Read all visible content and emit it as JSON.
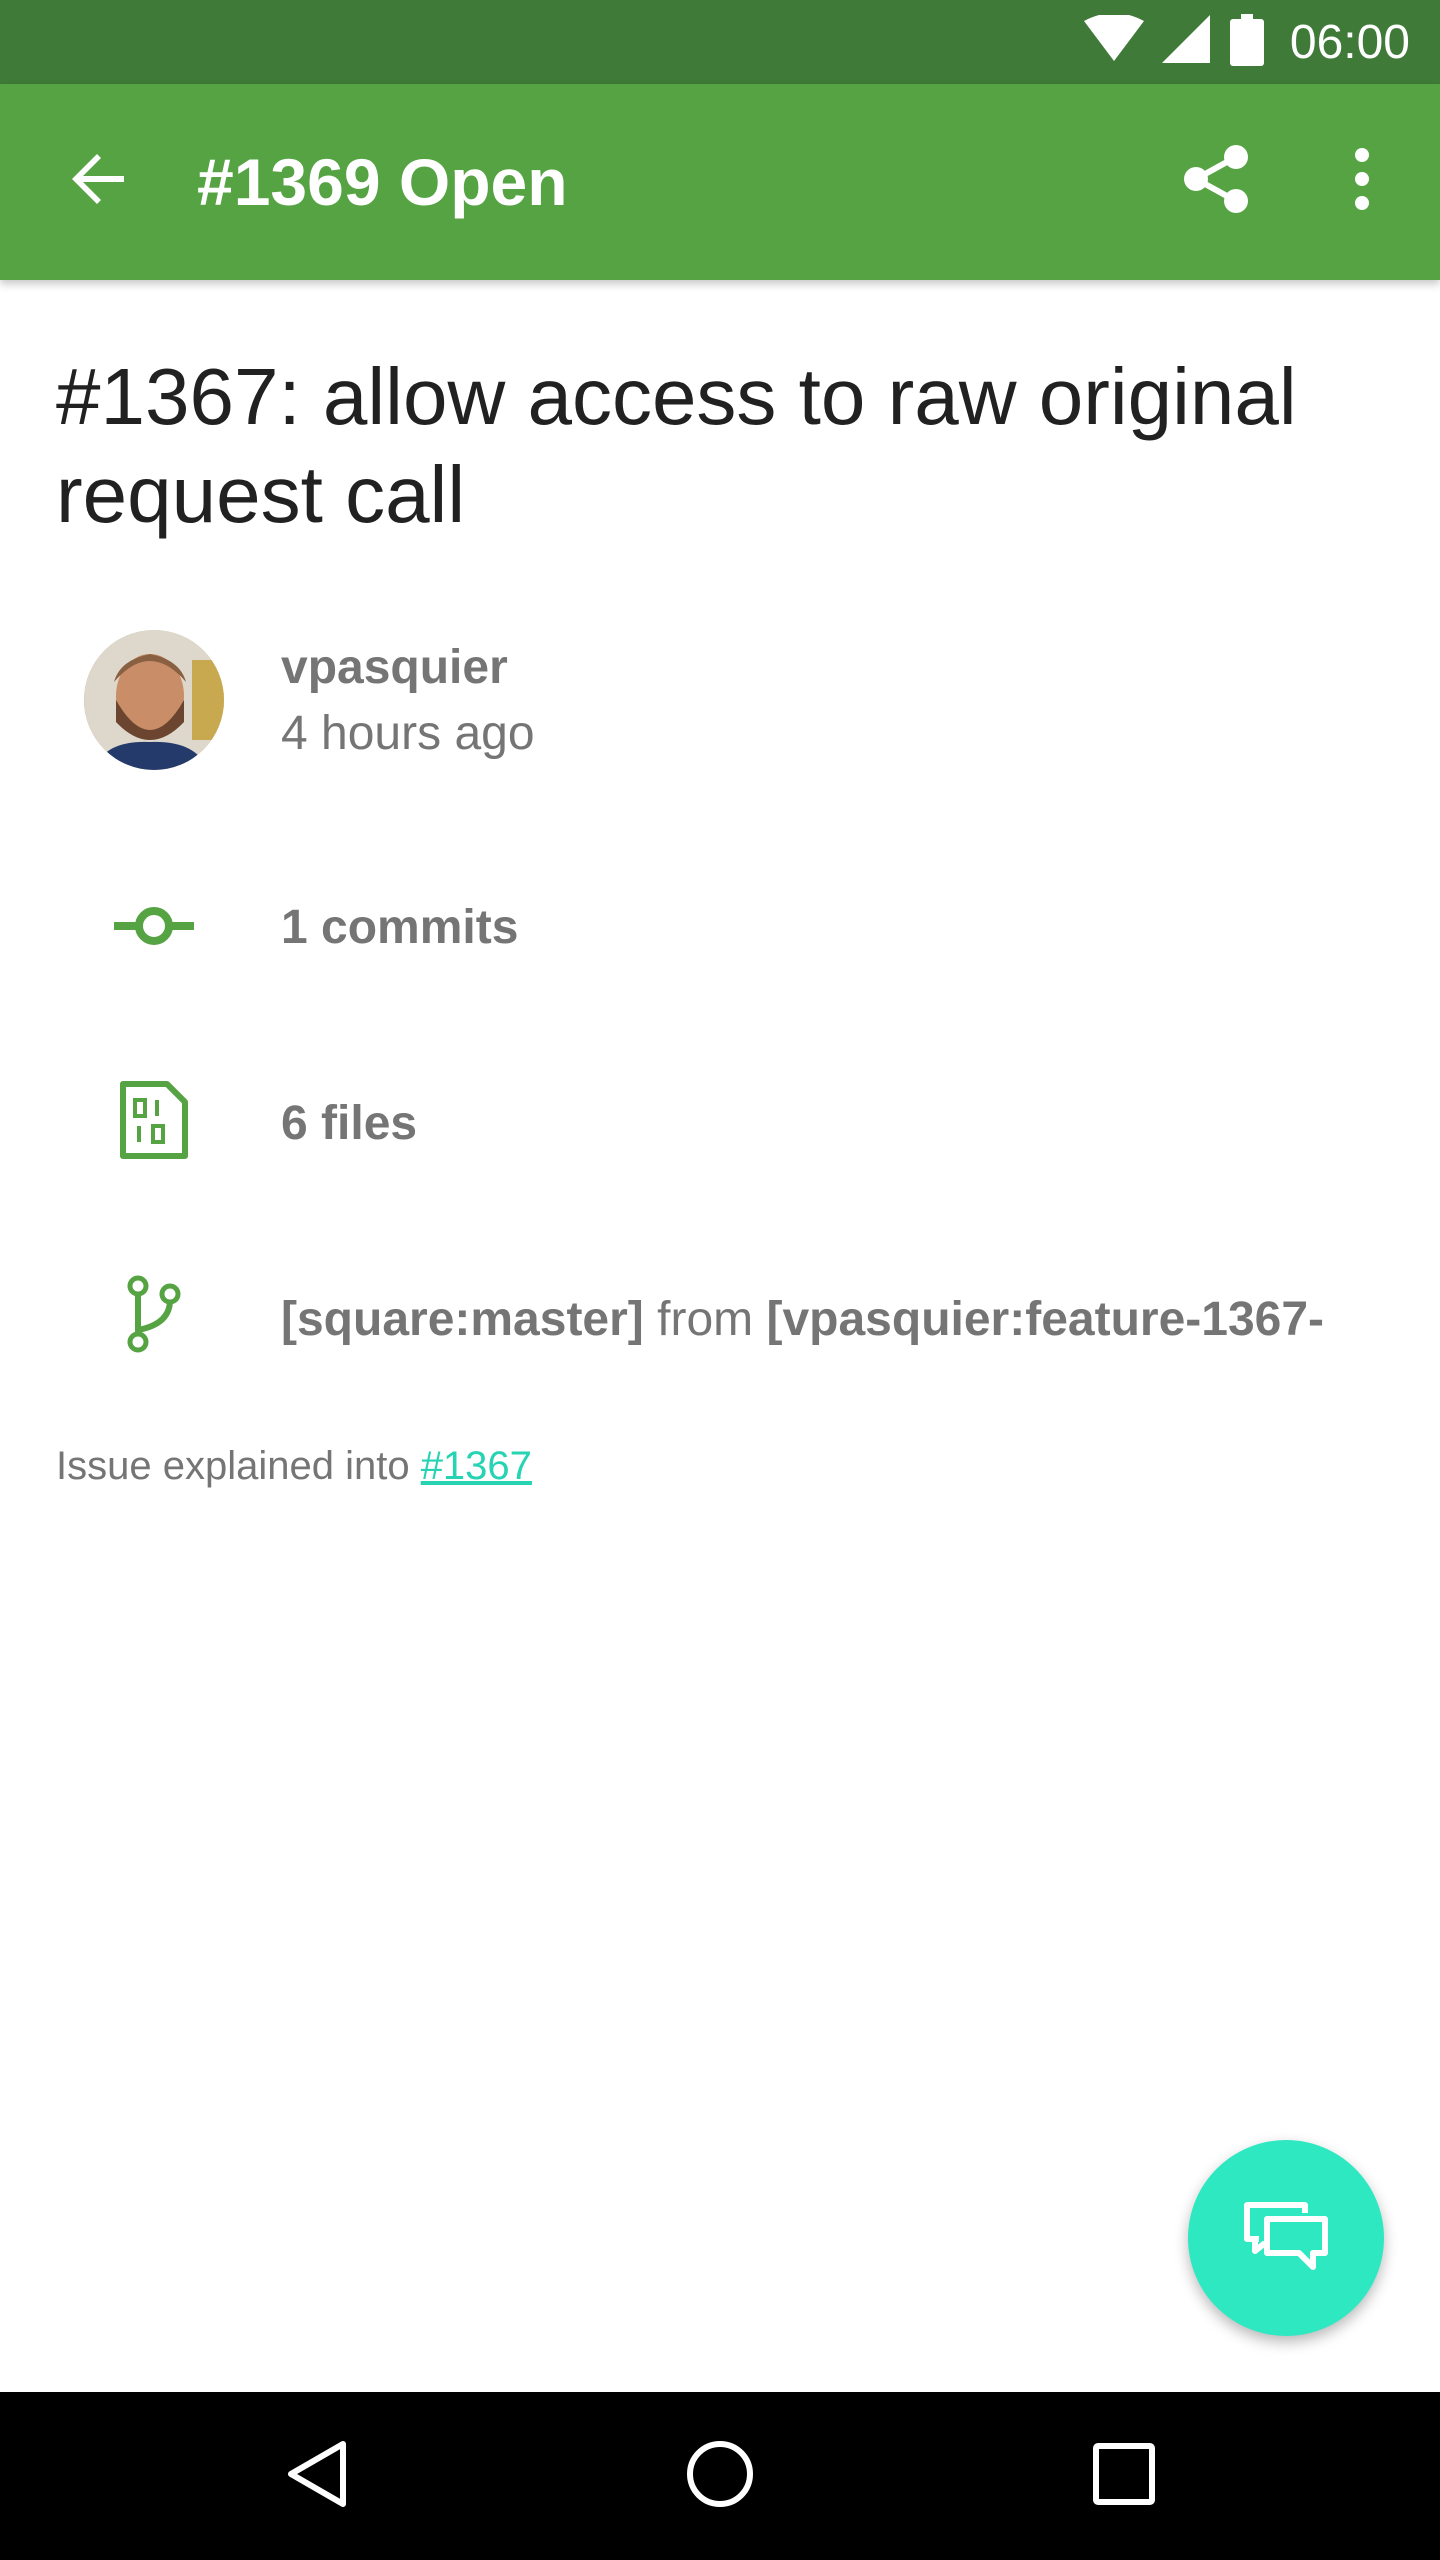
{
  "status_bar": {
    "time": "06:00",
    "icons": [
      "wifi-icon",
      "signal-icon",
      "battery-icon"
    ],
    "background": "#3f7a38"
  },
  "app_bar": {
    "title": "#1369 Open",
    "back_icon": "arrow-back-icon",
    "share_icon": "share-icon",
    "more_icon": "more-vert-icon",
    "background": "#55a343"
  },
  "issue": {
    "title": "#1367: allow access to raw original request call",
    "author": "vpasquier",
    "time": "4 hours ago",
    "commits": "1 commits",
    "files": "6 files",
    "branch": {
      "target": "[square:master]",
      "from_label": "from",
      "source": "[vpasquier:feature-1367-"
    },
    "description": {
      "text": "Issue explained into ",
      "link": "#1367"
    }
  },
  "fab": {
    "icon": "comments-icon",
    "color": "#2ee8c2"
  },
  "nav_bar": {
    "icons": [
      "back-triangle-icon",
      "home-circle-icon",
      "recents-square-icon"
    ]
  },
  "colors": {
    "accent_green": "#55a343",
    "link": "#26d3b3",
    "secondary_text": "#757575"
  }
}
